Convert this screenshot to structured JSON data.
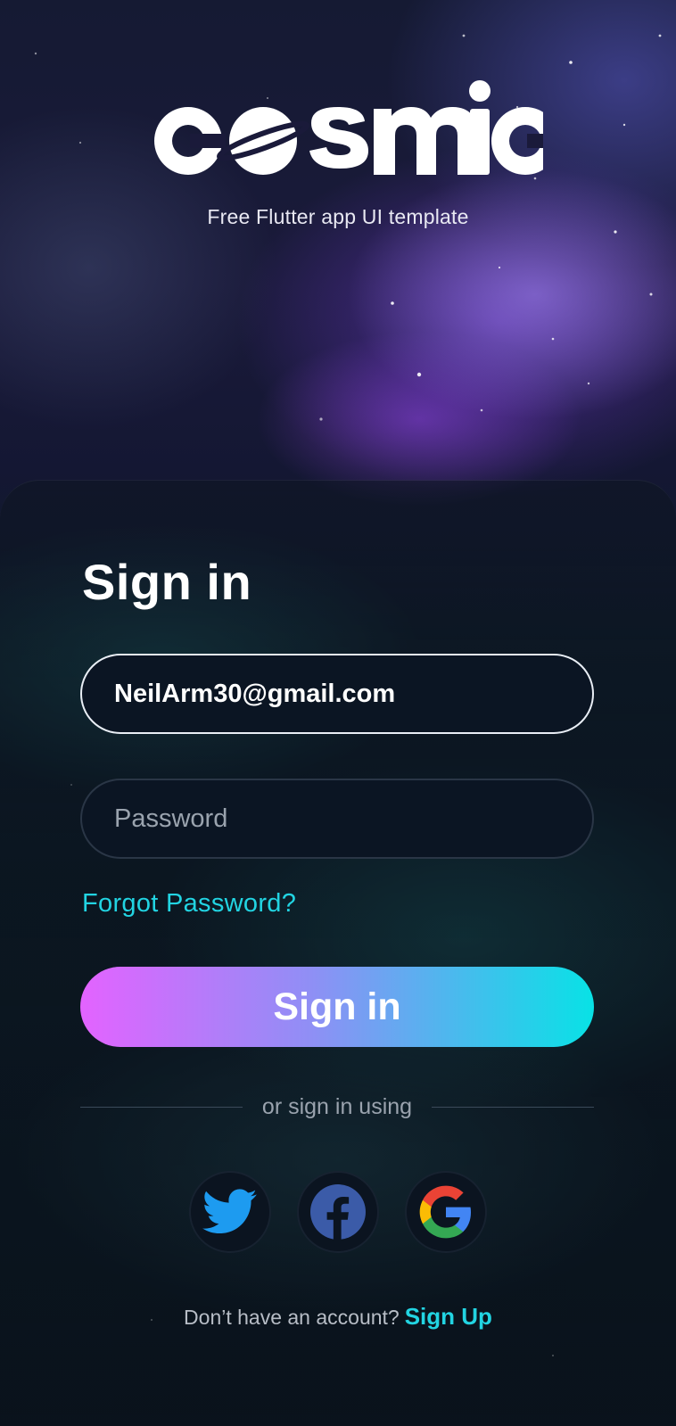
{
  "header": {
    "logo_text": "cosmic",
    "tagline": "Free Flutter app UI template"
  },
  "form": {
    "title": "Sign in",
    "email_value": "NeilArm30@gmail.com",
    "password_placeholder": "Password",
    "forgot_label": "Forgot Password?",
    "submit_label": "Sign in",
    "divider_text": "or sign in using"
  },
  "social": [
    {
      "name": "twitter-icon",
      "color": "#1d9bf0"
    },
    {
      "name": "facebook-icon",
      "color": "#3b5ba8"
    },
    {
      "name": "google-icon",
      "color": "#4285f4"
    }
  ],
  "footer": {
    "prompt": "Don’t have an account?",
    "signup_label": "Sign Up"
  },
  "colors": {
    "accent": "#22d4e2",
    "button_gradient_start": "#e363ff",
    "button_gradient_end": "#08e2e6",
    "background": "#0b1421"
  }
}
